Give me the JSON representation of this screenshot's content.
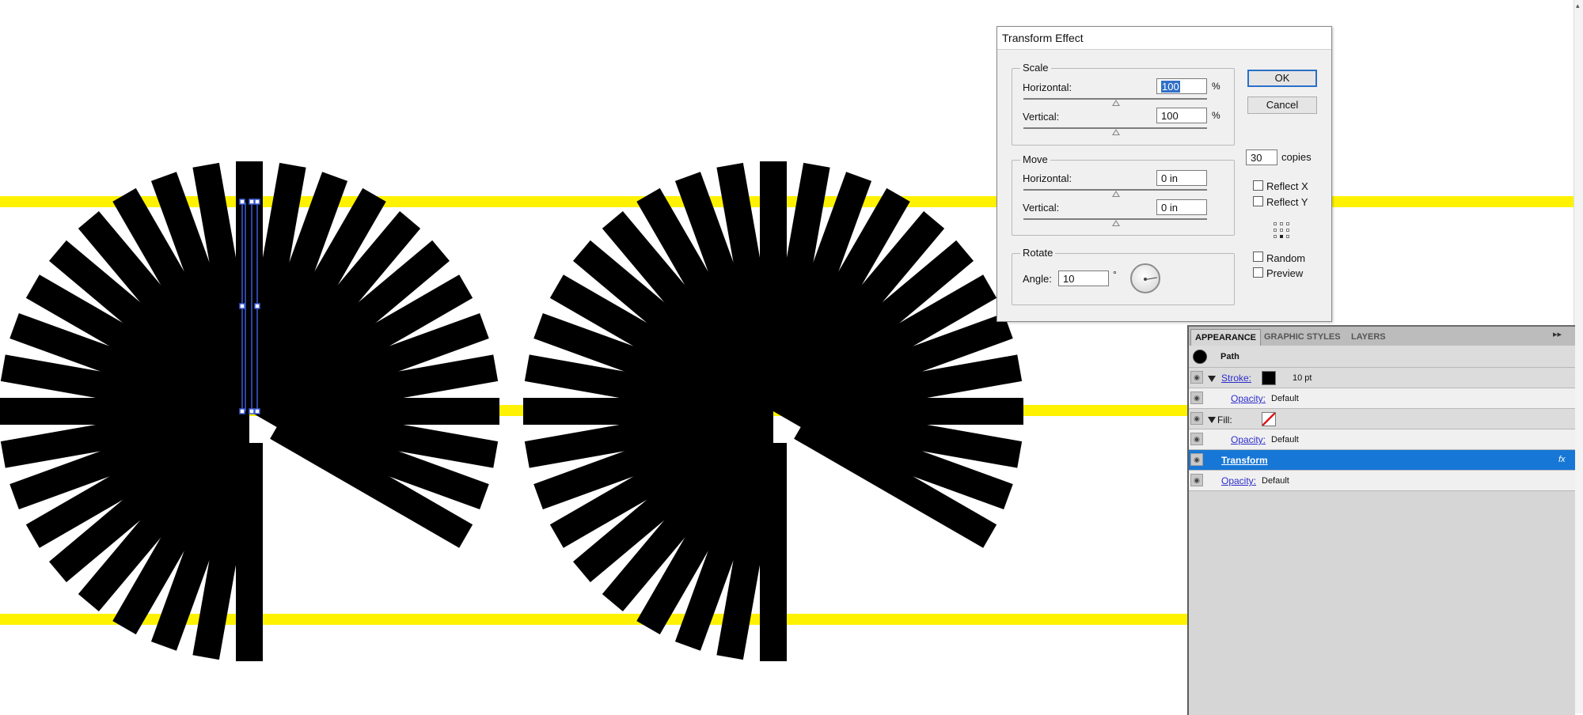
{
  "dialog": {
    "title": "Transform Effect",
    "scale": {
      "legend": "Scale",
      "horizontal_label": "Horizontal:",
      "horizontal_value": "100",
      "vertical_label": "Vertical:",
      "vertical_value": "100",
      "unit": "%"
    },
    "move": {
      "legend": "Move",
      "horizontal_label": "Horizontal:",
      "horizontal_value": "0 in",
      "vertical_label": "Vertical:",
      "vertical_value": "0 in"
    },
    "rotate": {
      "legend": "Rotate",
      "angle_label": "Angle:",
      "angle_value": "10",
      "degree_symbol": "°"
    },
    "ok_label": "OK",
    "cancel_label": "Cancel",
    "copies_value": "30",
    "copies_label": "copies",
    "reflect_x_label": "Reflect X",
    "reflect_y_label": "Reflect Y",
    "random_label": "Random",
    "preview_label": "Preview",
    "reflect_x_checked": false,
    "reflect_y_checked": false,
    "random_checked": false,
    "preview_checked": false
  },
  "panel": {
    "tabs": [
      "APPEARANCE",
      "GRAPHIC STYLES",
      "LAYERS"
    ],
    "active_tab": "APPEARANCE",
    "controls": "▸▸",
    "object_label": "Path",
    "rows": {
      "stroke_label": "Stroke:",
      "stroke_weight": "10 pt",
      "stroke_opacity_label": "Opacity:",
      "stroke_opacity_value": "Default",
      "fill_label": "Fill:",
      "fill_opacity_label": "Opacity:",
      "fill_opacity_value": "Default",
      "effect_label": "Transform",
      "effect_icon": "fx",
      "object_opacity_label": "Opacity:",
      "object_opacity_value": "Default"
    }
  },
  "canvas": {
    "guide_color": "#fff200",
    "shape_color": "#000000",
    "selection_color": "#3a5bd8",
    "transform_copies": 30,
    "rotate_step_degrees": 10
  }
}
